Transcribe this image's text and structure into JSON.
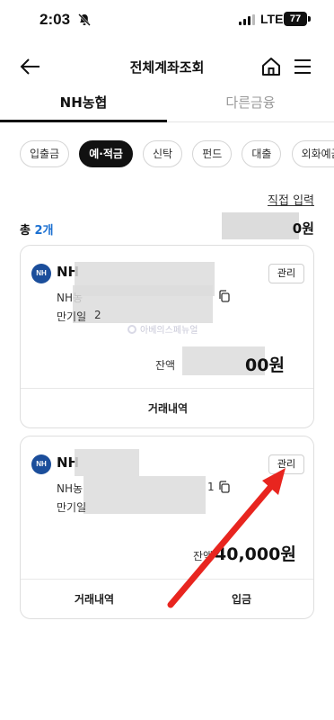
{
  "status_bar": {
    "time": "2:03",
    "network": "LTE",
    "battery": "77"
  },
  "header": {
    "title": "전체계좌조회"
  },
  "main_tabs": [
    {
      "label": "NH농협",
      "active": true
    },
    {
      "label": "다른금융",
      "active": false
    }
  ],
  "category_chips": [
    {
      "label": "입출금",
      "active": false
    },
    {
      "label": "예·적금",
      "active": true
    },
    {
      "label": "신탁",
      "active": false
    },
    {
      "label": "펀드",
      "active": false
    },
    {
      "label": "대출",
      "active": false
    },
    {
      "label": "외화예금",
      "active": false
    }
  ],
  "direct_input_label": "직접 입력",
  "summary": {
    "total_prefix": "총 ",
    "total_count": "2개",
    "total_amount_suffix": "0원"
  },
  "accounts": [
    {
      "name_visible": "NH",
      "manage_label": "관리",
      "account_no_prefix": "NH농",
      "maturity_label": "만기일",
      "maturity_visible": "2",
      "balance_label": "잔액",
      "balance_visible": "00원",
      "actions": [
        "거래내역"
      ]
    },
    {
      "name_visible": "NH",
      "manage_label": "관리",
      "account_no_prefix": "NH농",
      "account_no_suffix": "1",
      "maturity_label": "만기일",
      "balance_label": "잔액",
      "balance_visible": "40,000원",
      "actions": [
        "거래내역",
        "입금"
      ]
    }
  ],
  "watermark": "아베의스페뉴얼",
  "colors": {
    "accent": "#1a6fd1",
    "annotation_arrow": "#e8251f",
    "bank_logo": "#1b4e9b"
  }
}
